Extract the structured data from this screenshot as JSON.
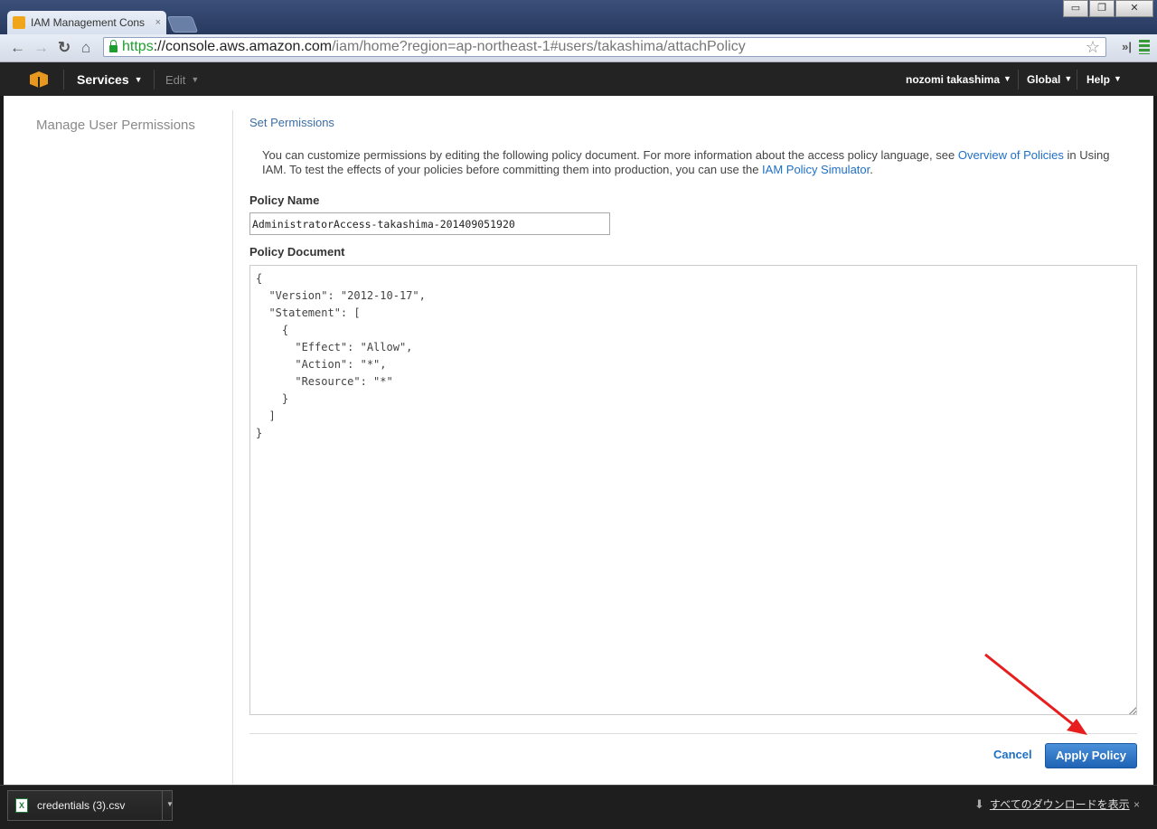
{
  "browser": {
    "tab_title": "IAM Management Cons",
    "tab_close": "×",
    "url_scheme": "https",
    "url_host": "://console.aws.amazon.com",
    "url_path": "/iam/home?region=ap-northeast-1#users/takashima/attachPolicy",
    "window_minimize": "▭",
    "window_restore": "❐",
    "window_close": "✕"
  },
  "aws": {
    "services_label": "Services",
    "edit_label": "Edit",
    "user_label": "nozomi takashima",
    "region_label": "Global",
    "help_label": "Help",
    "brand_color": "#e8971f"
  },
  "sidebar": {
    "title": "Manage User Permissions"
  },
  "main": {
    "breadcrumb": "Set Permissions",
    "desc_part1": "You can customize permissions by editing the following policy document. For more information about the access policy language, see ",
    "link_overview": "Overview of Policies",
    "desc_part2": " in Using IAM. To test the effects of your policies before committing them into production, you can use the ",
    "link_simulator": "IAM Policy Simulator",
    "desc_part3": ".",
    "policy_name_label": "Policy Name",
    "policy_name_value": "AdministratorAccess-takashima-201409051920",
    "policy_document_label": "Policy Document",
    "policy_document": "{\n  \"Version\": \"2012-10-17\",\n  \"Statement\": [\n    {\n      \"Effect\": \"Allow\",\n      \"Action\": \"*\",\n      \"Resource\": \"*\"\n    }\n  ]\n}",
    "cancel_label": "Cancel",
    "apply_label": "Apply Policy",
    "apply_color": "#1f63b5"
  },
  "downloads": {
    "file_name": "credentials (3).csv",
    "file_icon": "X",
    "show_all": "すべてのダウンロードを表示",
    "close": "×"
  },
  "annotation": {
    "arrow_color": "#e81e1e"
  }
}
